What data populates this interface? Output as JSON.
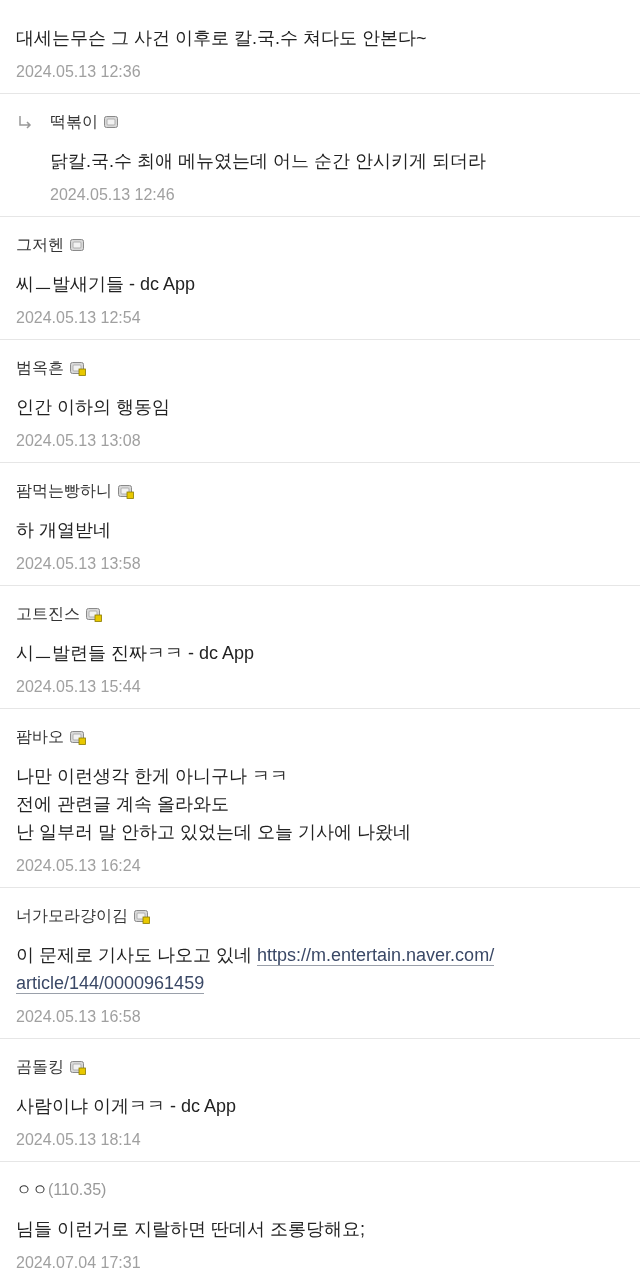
{
  "comments": [
    {
      "lines": [
        "대세는무슨 그 사건 이후로 칼.국.수 쳐다도 안본다~"
      ],
      "date": "2024.05.13 12:36",
      "reply": false
    },
    {
      "author": "떡볶이",
      "semi_fixed": false,
      "lines": [
        "닭칼.국.수 최애 메뉴였는데 어느 순간 안시키게 되더라"
      ],
      "date": "2024.05.13 12:46",
      "reply": true
    },
    {
      "author": "그저헨",
      "semi_fixed": false,
      "lines": [
        "씨ㅡ발새기들 - dc App"
      ],
      "date": "2024.05.13 12:54",
      "reply": false
    },
    {
      "author": "범옥흔",
      "semi_fixed": true,
      "lines": [
        "인간 이하의 행동임"
      ],
      "date": "2024.05.13 13:08",
      "reply": false
    },
    {
      "author": "팜먹는빵하니",
      "semi_fixed": true,
      "lines": [
        "하 개열받네"
      ],
      "date": "2024.05.13 13:58",
      "reply": false
    },
    {
      "author": "고트진스",
      "semi_fixed": true,
      "lines": [
        "시ㅡ발련들 진짜ㅋㅋ - dc App"
      ],
      "date": "2024.05.13 15:44",
      "reply": false
    },
    {
      "author": "팜바오",
      "semi_fixed": true,
      "lines": [
        "나만 이런생각 한게 아니구나 ㅋㅋ",
        "전에 관련글 계속 올라와도",
        "난 일부러 말 안하고 있었는데 오늘 기사에 나왔네"
      ],
      "date": "2024.05.13 16:24",
      "reply": false
    },
    {
      "author": "너가모라걍이김",
      "semi_fixed": true,
      "lines": [
        "이 문제로 기사도 나오고 있네 "
      ],
      "link_lines": [
        "https://m.entertain.naver.com/",
        "article/144/0000961459"
      ],
      "date": "2024.05.13 16:58",
      "reply": false
    },
    {
      "author": "곰돌킹",
      "semi_fixed": true,
      "lines": [
        "사람이냐 이게ㅋㅋ - dc App"
      ],
      "date": "2024.05.13 18:14",
      "reply": false
    },
    {
      "author": "ㅇㅇ",
      "ip": "(110.35)",
      "lines": [
        "님들 이런거로 지랄하면 딴데서 조롱당해요;"
      ],
      "date": "2024.07.04 17:31",
      "reply": false
    }
  ]
}
